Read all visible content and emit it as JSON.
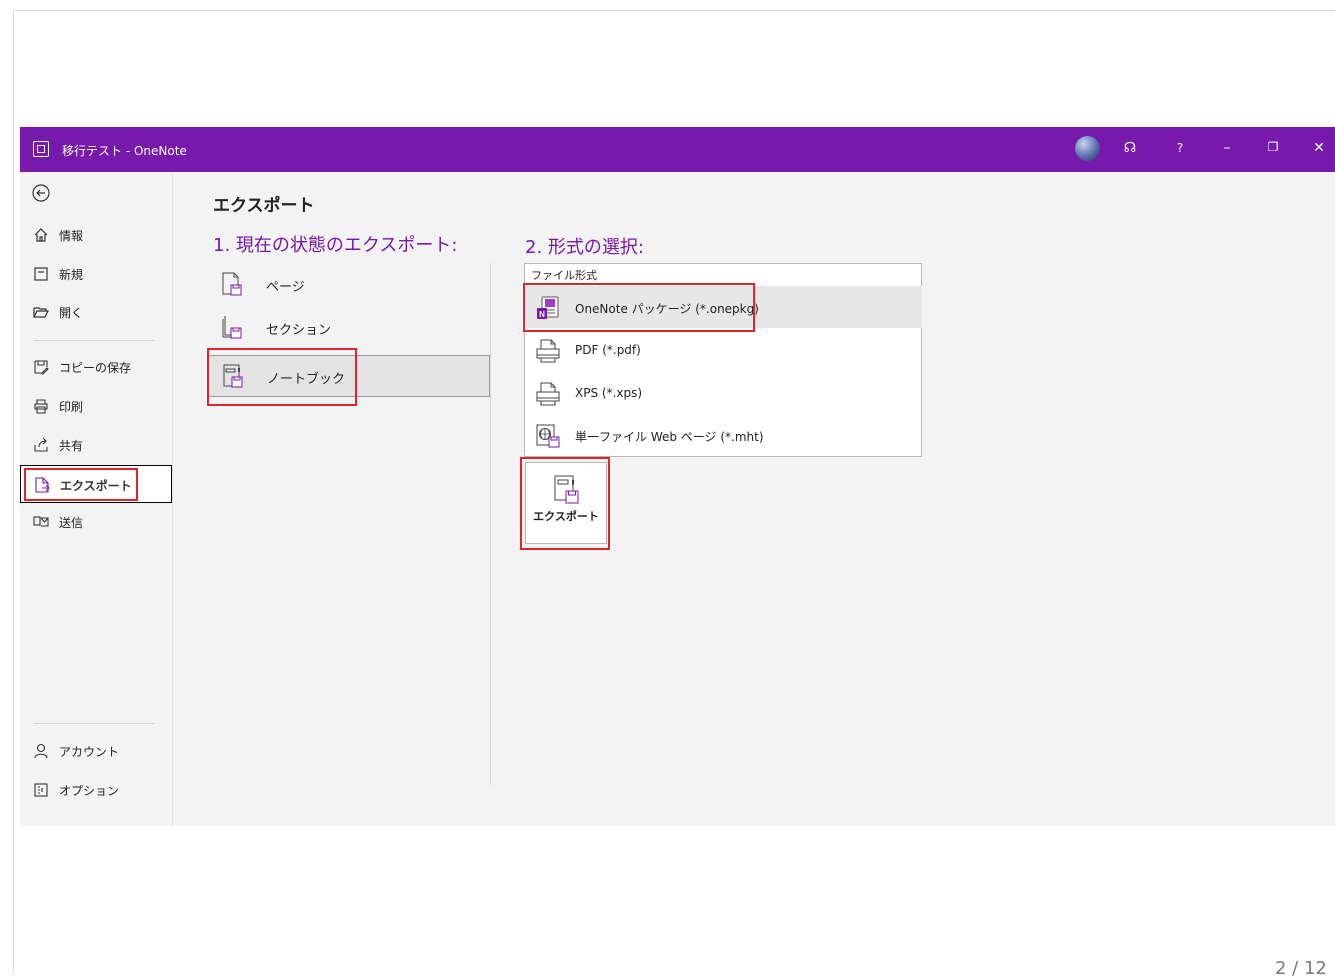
{
  "window": {
    "title": "移行テスト - OneNote",
    "controls": {
      "coauthor": "☊",
      "help": "?",
      "minimize": "–",
      "restore": "❐",
      "close": "✕"
    }
  },
  "sidebar": {
    "back_icon": "back-arrow-icon",
    "items": [
      {
        "label": "情報",
        "icon": "home-icon"
      },
      {
        "label": "新規",
        "icon": "new-page-icon"
      },
      {
        "label": "開く",
        "icon": "folder-open-icon"
      },
      {
        "label": "コピーの保存",
        "icon": "save-copy-icon"
      },
      {
        "label": "印刷",
        "icon": "print-icon"
      },
      {
        "label": "共有",
        "icon": "share-icon"
      },
      {
        "label": "エクスポート",
        "icon": "export-icon",
        "selected": true
      },
      {
        "label": "送信",
        "icon": "send-icon"
      },
      {
        "label": "アカウント",
        "icon": "account-icon"
      },
      {
        "label": "オプション",
        "icon": "options-icon"
      }
    ]
  },
  "main": {
    "heading": "エクスポート",
    "step1": "1. 現在の状態のエクスポート:",
    "step2": "2. 形式の選択:",
    "scopes": [
      {
        "label": "ページ"
      },
      {
        "label": "セクション"
      },
      {
        "label": "ノートブック",
        "selected": true
      }
    ],
    "formats": {
      "header": "ファイル形式",
      "items": [
        {
          "label": "OneNote パッケージ (*.onepkg)",
          "selected": true
        },
        {
          "label": "PDF (*.pdf)"
        },
        {
          "label": "XPS (*.xps)"
        },
        {
          "label": "単一ファイル Web ページ (*.mht)"
        }
      ]
    },
    "export_button": "エクスポート"
  },
  "colors": {
    "accent": "#7719aa",
    "highlight_box": "#e0242b"
  },
  "page_number": "2 / 12"
}
